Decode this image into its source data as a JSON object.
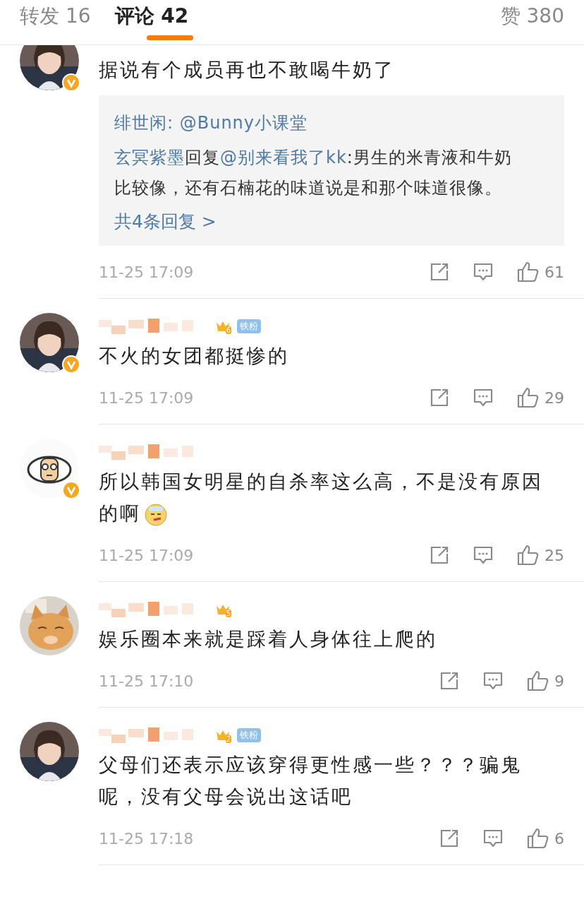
{
  "tabs": [
    {
      "label": "转发 16",
      "selected": false
    },
    {
      "label": "评论 42",
      "selected": true
    }
  ],
  "likes_tab": "赞 380",
  "comments": [
    {
      "verified": true,
      "text": "据说有个成员再也不敢喝牛奶了",
      "reply": {
        "lines": [
          [
            {
              "kind": "user",
              "text": "绯世闲:"
            },
            {
              "kind": "user",
              "text": " @Bunny小课堂"
            }
          ],
          [
            {
              "kind": "user",
              "text": "玄冥紫墨"
            },
            {
              "kind": "text",
              "text": "回复"
            },
            {
              "kind": "user",
              "text": "@别来看我了kk"
            },
            {
              "kind": "text",
              "text": ":男生的米青液和牛奶比较像，还有石楠花的味道说是和那个味道很像。"
            }
          ]
        ],
        "more": "共4条回复 >"
      },
      "time": "11-25 17:09",
      "like_count": "61"
    },
    {
      "verified": true,
      "crown_level": "6",
      "fan_badge": "铁粉",
      "text": "不火的女团都挺惨的",
      "time": "11-25 17:09",
      "like_count": "29"
    },
    {
      "verified": true,
      "text": "所以韩国女明星的自杀率这么高，不是没有原因的啊",
      "emoji": true,
      "time": "11-25 17:09",
      "like_count": "25"
    },
    {
      "verified": false,
      "crown_level": "5",
      "text": "娱乐圈本来就是踩着人身体往上爬的",
      "time": "11-25 17:10",
      "like_count": "9"
    },
    {
      "verified": false,
      "crown_level": "2",
      "fan_badge": "铁粉",
      "text": "父母们还表示应该穿得更性感一些？？？骗鬼呢，没有父母会说出这话吧",
      "time": "11-25 17:18",
      "like_count": "6"
    }
  ]
}
